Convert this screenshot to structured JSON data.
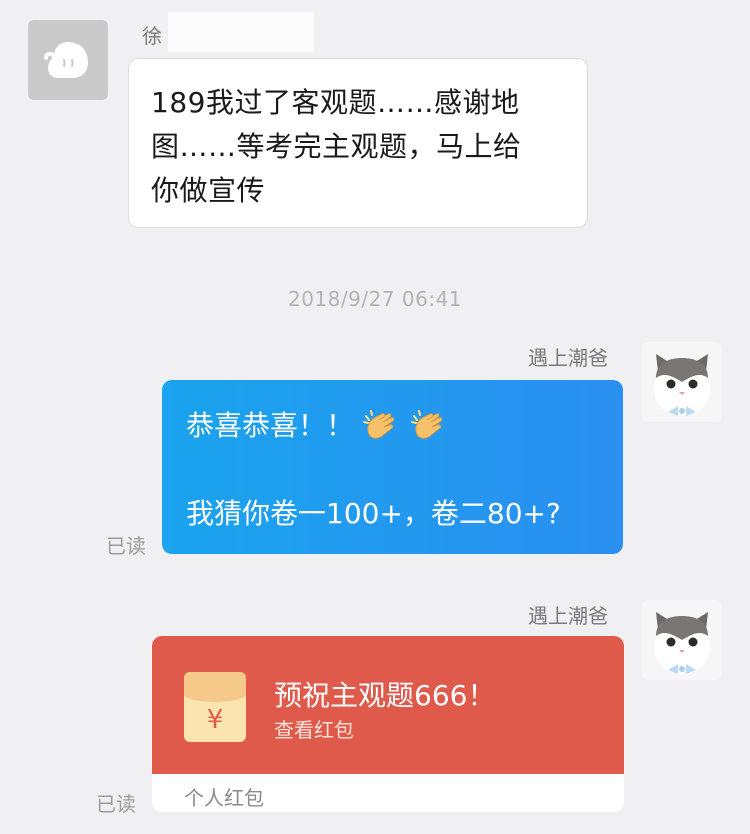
{
  "incoming": {
    "sender_name": "徐",
    "message_line1": "189我过了客观题……感谢地",
    "message_line2": "图……等考完主观题，马上给",
    "message_line3": "你做宣传"
  },
  "timestamp": "2018/9/27 06:41",
  "outgoing_text": {
    "sender_name": "遇上潮爸",
    "line1": "恭喜恭喜！！",
    "line2": "我猜你卷一100+，卷二80+?",
    "read_status": "已读"
  },
  "outgoing_red_packet": {
    "sender_name": "遇上潮爸",
    "title": "预祝主观题666！",
    "subtitle": "查看红包",
    "footer": "个人红包",
    "icon_symbol": "¥",
    "read_status": "已读"
  },
  "colors": {
    "background": "#f0f0f2",
    "outgoing_bubble": "#1aa3ee",
    "red_packet": "#e05a4c",
    "timestamp": "#b3b3b3"
  },
  "icons": {
    "incoming_avatar": "default-qq-avatar-icon",
    "outgoing_avatar": "cat-avatar",
    "emoji": "clapping-hands-icon",
    "red_packet": "red-envelope-icon"
  }
}
